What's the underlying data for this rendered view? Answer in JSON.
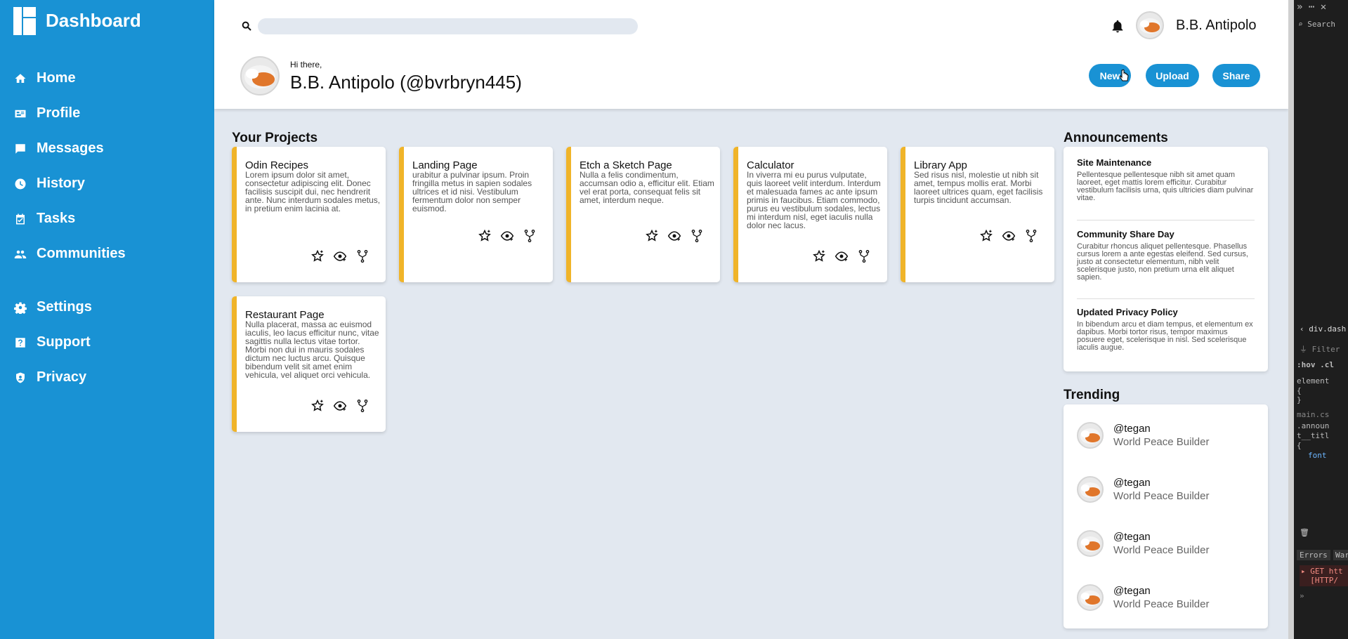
{
  "sidebar": {
    "title": "Dashboard",
    "items": [
      {
        "label": "Home",
        "icon": "home-icon"
      },
      {
        "label": "Profile",
        "icon": "id-card-icon"
      },
      {
        "label": "Messages",
        "icon": "message-icon"
      },
      {
        "label": "History",
        "icon": "clock-icon"
      },
      {
        "label": "Tasks",
        "icon": "calendar-check-icon"
      },
      {
        "label": "Communities",
        "icon": "people-icon"
      },
      {
        "label": "Settings",
        "icon": "gear-icon"
      },
      {
        "label": "Support",
        "icon": "help-icon"
      },
      {
        "label": "Privacy",
        "icon": "shield-icon"
      }
    ]
  },
  "header": {
    "search_value": "",
    "username": "B.B. Antipolo",
    "greeting": "Hi there,",
    "user_handle": "B.B. Antipolo (@bvrbryn445)",
    "buttons": {
      "new": "New",
      "upload": "Upload",
      "share": "Share"
    }
  },
  "projects": {
    "title": "Your Projects",
    "items": [
      {
        "title": "Odin Recipes",
        "desc": "Lorem ipsum dolor sit amet, consectetur adipiscing elit. Donec facilisis suscipit dui, nec hendrerit ante. Nunc interdum sodales metus, in pretium enim lacinia at."
      },
      {
        "title": "Landing Page",
        "desc": "urabitur a pulvinar ipsum. Proin fringilla metus in sapien sodales ultrices et id nisi. Vestibulum fermentum dolor non semper euismod."
      },
      {
        "title": "Etch a Sketch Page",
        "desc": "Nulla a felis condimentum, accumsan odio a, efficitur elit. Etiam vel erat porta, consequat felis sit amet, interdum neque."
      },
      {
        "title": "Calculator",
        "desc": "In viverra mi eu purus vulputate, quis laoreet velit interdum. Interdum et malesuada fames ac ante ipsum primis in faucibus. Etiam commodo, purus eu vestibulum sodales, lectus mi interdum nisl, eget iaculis nulla dolor nec lacus."
      },
      {
        "title": "Library App",
        "desc": "Sed risus nisl, molestie ut nibh sit amet, tempus mollis erat. Morbi laoreet ultrices quam, eget facilisis turpis tincidunt accumsan."
      },
      {
        "title": "Restaurant Page",
        "desc": "Nulla placerat, massa ac euismod iaculis, leo lacus efficitur nunc, vitae sagittis nulla lectus vitae tortor. Morbi non dui in mauris sodales dictum nec luctus arcu. Quisque bibendum velit sit amet enim vehicula, vel aliquet orci vehicula."
      }
    ]
  },
  "announcements": {
    "title": "Announcements",
    "items": [
      {
        "title": "Site Maintenance",
        "text": "Pellentesque pellentesque nibh sit amet quam laoreet, eget mattis lorem efficitur. Curabitur vestibulum facilisis urna, quis ultricies diam pulvinar vitae."
      },
      {
        "title": "Community Share Day",
        "text": "Curabitur rhoncus aliquet pellentesque. Phasellus cursus lorem a ante egestas eleifend. Sed cursus, justo at consectetur elementum, nibh velit scelerisque justo, non pretium urna elit aliquet sapien."
      },
      {
        "title": "Updated Privacy Policy",
        "text": "In bibendum arcu et diam tempus, et elementum ex dapibus. Morbi tortor risus, tempor maximus posuere eget, scelerisque in nisl. Sed scelerisque iaculis augue."
      }
    ]
  },
  "trending": {
    "title": "Trending",
    "items": [
      {
        "handle": "@tegan",
        "sub": "World Peace Builder"
      },
      {
        "handle": "@tegan",
        "sub": "World Peace Builder"
      },
      {
        "handle": "@tegan",
        "sub": "World Peace Builder"
      },
      {
        "handle": "@tegan",
        "sub": "World Peace Builder"
      }
    ]
  },
  "devtools": {
    "search": "Search",
    "breadcrumb": "div.dash",
    "filter": "Filter",
    "hov": ":hov .cl",
    "element": "element",
    "file": "main.cs",
    "rule": ".announ t__titl",
    "font": "font",
    "errors": "Errors",
    "warnings": "War",
    "get": "GET htt",
    "http": "[HTTP/"
  },
  "colors": {
    "sidebar": "#1992d4",
    "accent": "#f0b429",
    "background": "#e2e8f0"
  }
}
